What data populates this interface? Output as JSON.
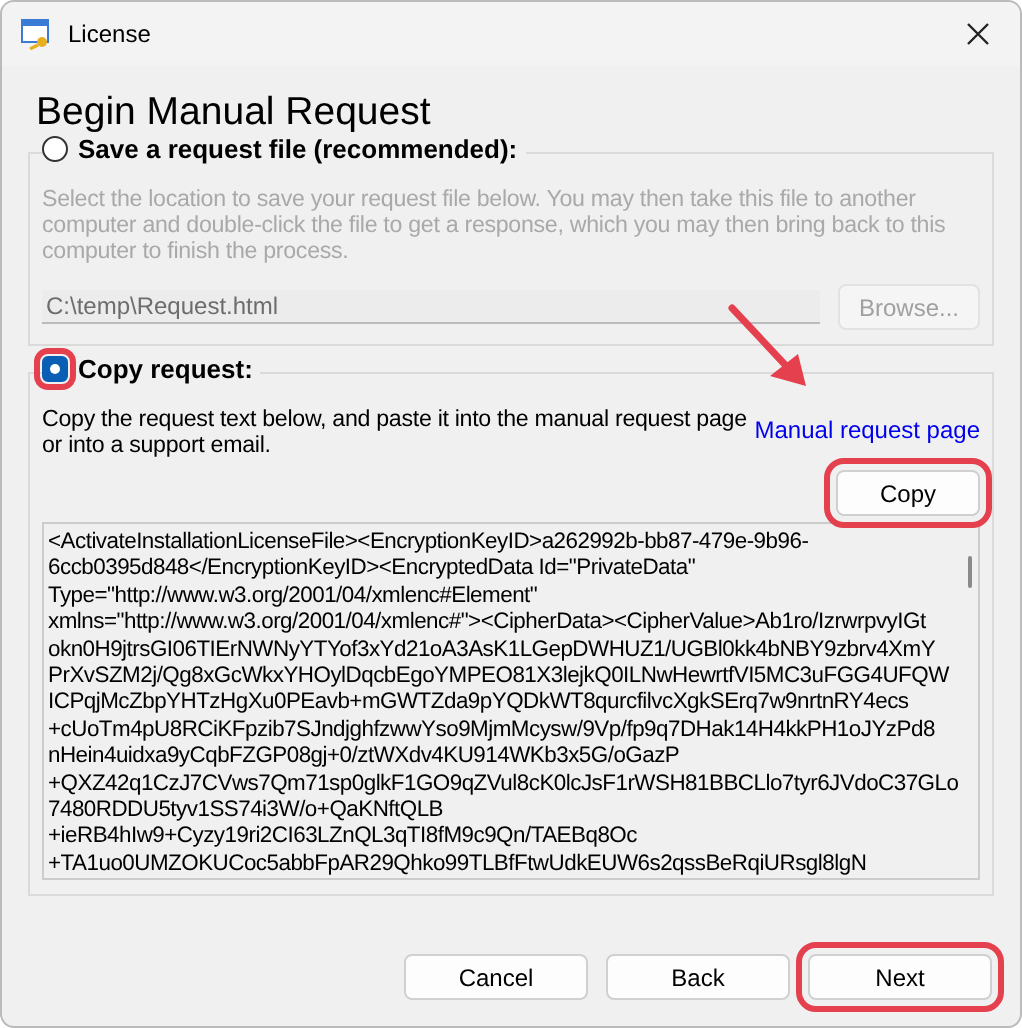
{
  "window": {
    "title": "License"
  },
  "heading": "Begin Manual Request",
  "options": [
    {
      "label": "Save a request file (recommended):",
      "selected": false,
      "highlighted": false,
      "description": "Select the location to save your request file below.  You may then take this file to another computer and double-click the file to get a response, which you may then bring back to this computer to finish the process.",
      "path_field": {
        "value": "C:\\temp\\Request.html"
      },
      "browse_button": {
        "label": "Browse..."
      }
    },
    {
      "label": "Copy request:",
      "selected": true,
      "highlighted": true,
      "description": "Copy the request text below, and paste it into the manual request page or into a support email.",
      "link": {
        "label": "Manual request page",
        "pointed_at": true
      },
      "copy_button": {
        "label": "Copy",
        "highlighted": true
      },
      "request_text": [
        "<ActivateInstallationLicenseFile><EncryptionKeyID>a262992b-bb87-479e-9b96-",
        "6ccb0395d848</EncryptionKeyID><EncryptedData Id=\"PrivateData\"",
        "Type=\"http://www.w3.org/2001/04/xmlenc#Element\"",
        "xmlns=\"http://www.w3.org/2001/04/xmlenc#\"><CipherData><CipherValue>Ab1ro/IzrwrpvyIGt",
        "okn0H9jtrsGI06TIErNWNyYTYof3xYd21oA3AsK1LGepDWHUZ1/UGBl0kk4bNBY9zbrv4XmY",
        "PrXvSZM2j/Qg8xGcWkxYHOylDqcbEgoYMPEO81X3lejkQ0ILNwHewrtfVI5MC3uFGG4UFQW",
        "ICPqjMcZbpYHTzHgXu0PEavb+mGWTZda9pYQDkWT8qurcfilvcXgkSErq7w9nrtnRY4ecs",
        "+cUoTm4pU8RCiKFpzib7SJndjghfzwwYso9MjmMcysw/9Vp/fp9q7DHak14H4kkPH1oJYzPd8",
        "nHein4uidxa9yCqbFZGP08gj+0/ztWXdv4KU914WKb3x5G/oGazP",
        "+QXZ42q1CzJ7CVws7Qm71sp0glkF1GO9qZVul8cK0lcJsF1rWSH81BBCLlo7tyr6JVdoC37GLo",
        "7480RDDU5tyv1SS74i3W/o+QaKNftQLB",
        "+ieRB4hIw9+Cyzy19ri2CI63LZnQL3qTI8fM9c9Qn/TAEBq8Oc",
        "+TA1uo0UMZOKUCoc5abbFpAR29Qhko99TLBfFtwUdkEUW6s2qssBeRqiURsgl8lgN"
      ]
    }
  ],
  "buttons": [
    {
      "label": "Cancel",
      "highlighted": false
    },
    {
      "label": "Back",
      "highlighted": false
    },
    {
      "label": "Next",
      "highlighted": true
    }
  ]
}
